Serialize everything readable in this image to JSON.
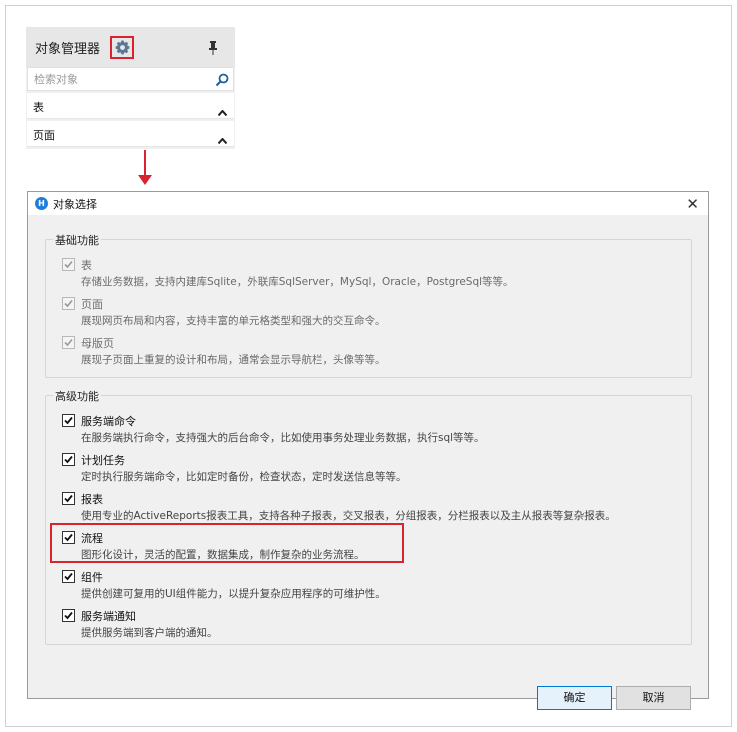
{
  "object_manager": {
    "title": "对象管理器",
    "search_placeholder": "检索对象",
    "rows": [
      {
        "label": "表"
      },
      {
        "label": "页面"
      }
    ]
  },
  "dialog": {
    "title": "对象选择",
    "close_glyph": "✕",
    "basic_group": {
      "title": "基础功能",
      "items": [
        {
          "name": "表",
          "desc": "存储业务数据，支持内建库Sqlite，外联库SqlServer，MySql，Oracle，PostgreSql等等。",
          "checked": true,
          "disabled": true
        },
        {
          "name": "页面",
          "desc": "展现网页布局和内容，支持丰富的单元格类型和强大的交互命令。",
          "checked": true,
          "disabled": true
        },
        {
          "name": "母版页",
          "desc": "展现子页面上重复的设计和布局，通常会显示导航栏，头像等等。",
          "checked": true,
          "disabled": true
        }
      ]
    },
    "advanced_group": {
      "title": "高级功能",
      "items": [
        {
          "name": "服务端命令",
          "desc": "在服务端执行命令，支持强大的后台命令，比如使用事务处理业务数据，执行sql等等。",
          "checked": true,
          "disabled": false
        },
        {
          "name": "计划任务",
          "desc": "定时执行服务端命令，比如定时备份，检查状态，定时发送信息等等。",
          "checked": true,
          "disabled": false
        },
        {
          "name": "报表",
          "desc": "使用专业的ActiveReports报表工具，支持各种子报表，交叉报表，分组报表，分栏报表以及主从报表等复杂报表。",
          "checked": true,
          "disabled": false
        },
        {
          "name": "流程",
          "desc": "图形化设计，灵活的配置，数据集成，制作复杂的业务流程。",
          "checked": true,
          "disabled": false
        },
        {
          "name": "组件",
          "desc": "提供创建可复用的UI组件能力，以提升复杂应用程序的可维护性。",
          "checked": true,
          "disabled": false
        },
        {
          "name": "服务端通知",
          "desc": "提供服务端到客户端的通知。",
          "checked": true,
          "disabled": false
        }
      ]
    },
    "ok_label": "确定",
    "cancel_label": "取消"
  },
  "colors": {
    "highlight": "#d9232e",
    "dialog_bg": "#f0f0f0",
    "primary_button_border": "#0078d7"
  },
  "icons": [
    "gear-icon",
    "pin-icon",
    "search-icon",
    "chevron-up-icon",
    "app-logo-icon",
    "close-icon",
    "checkmark-icon",
    "arrow-down-icon"
  ]
}
